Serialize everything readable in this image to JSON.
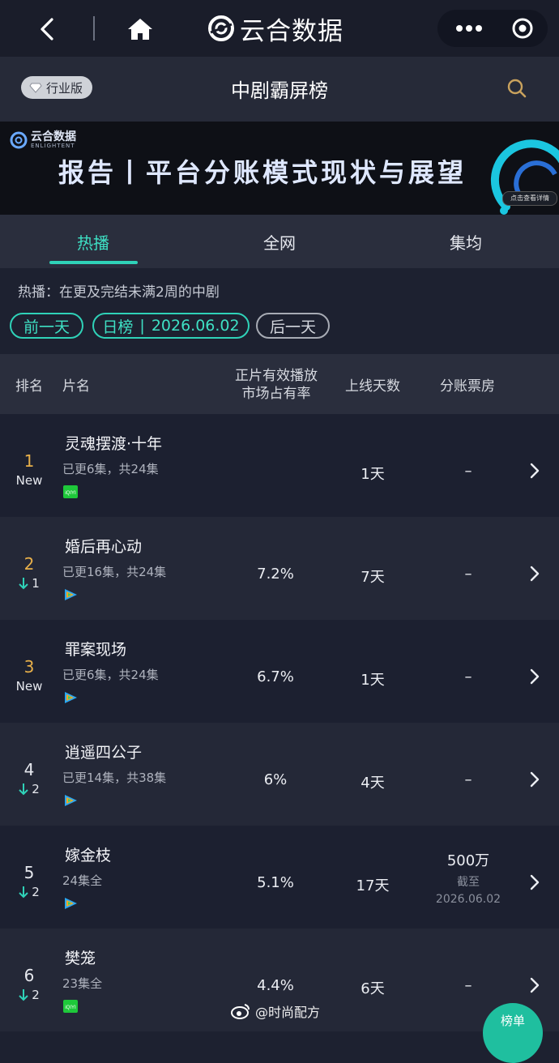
{
  "app": {
    "brand": "云合数据"
  },
  "header": {
    "edition_badge": "行业版",
    "title": "中剧霸屏榜"
  },
  "banner": {
    "logo_text": "云合数据",
    "logo_sub": "ENLIGHTENT",
    "headline": "报告丨平台分账模式现状与展望",
    "cta": "点击查看详情"
  },
  "tabs": [
    {
      "label": "热播",
      "active": true
    },
    {
      "label": "全网",
      "active": false
    },
    {
      "label": "集均",
      "active": false
    }
  ],
  "filter": {
    "description": "热播：在更及完结未满2周的中剧",
    "prev_day": "前一天",
    "board_type": "日榜",
    "date": "2026.06.02",
    "next_day": "后一天"
  },
  "table": {
    "headers": {
      "rank": "排名",
      "title": "片名",
      "share_line1": "正片有效播放",
      "share_line2": "市场占有率",
      "days": "上线天数",
      "box_office": "分账票房"
    },
    "rows": [
      {
        "rank": "1",
        "change": "New",
        "title": "灵魂摆渡·十年",
        "episodes": "已更6集，共24集",
        "platform": "iqiyi-icon",
        "share": "",
        "days": "1天",
        "box_office": "–",
        "box_note1": "",
        "box_note2": ""
      },
      {
        "rank": "2",
        "change": "1",
        "change_dir": "down",
        "title": "婚后再心动",
        "episodes": "已更16集，共24集",
        "platform": "tencent-video-icon",
        "share": "7.2%",
        "days": "7天",
        "box_office": "–",
        "box_note1": "",
        "box_note2": ""
      },
      {
        "rank": "3",
        "change": "New",
        "title": "罪案现场",
        "episodes": "已更6集，共24集",
        "platform": "tencent-video-icon",
        "share": "6.7%",
        "days": "1天",
        "box_office": "–",
        "box_note1": "",
        "box_note2": ""
      },
      {
        "rank": "4",
        "change": "2",
        "change_dir": "down",
        "title": "逍遥四公子",
        "episodes": "已更14集，共38集",
        "platform": "tencent-video-icon",
        "share": "6%",
        "days": "4天",
        "box_office": "–",
        "box_note1": "",
        "box_note2": ""
      },
      {
        "rank": "5",
        "change": "2",
        "change_dir": "down",
        "title": "嫁金枝",
        "episodes": "24集全",
        "platform": "tencent-video-icon",
        "share": "5.1%",
        "days": "17天",
        "box_office": "500万",
        "box_note1": "截至",
        "box_note2": "2026.06.02"
      },
      {
        "rank": "6",
        "change": "2",
        "change_dir": "down",
        "title": "樊笼",
        "episodes": "23集全",
        "platform": "iqiyi-icon",
        "share": "4.4%",
        "days": "6天",
        "box_office": "–",
        "box_note1": "",
        "box_note2": ""
      }
    ]
  },
  "watermark": "@时尚配方",
  "float_button": "榜单",
  "colors": {
    "accent": "#2fd2b8",
    "rank_gold": "#e8b04a",
    "down_arrow": "#2fd2b8",
    "background": "#1d2130"
  }
}
